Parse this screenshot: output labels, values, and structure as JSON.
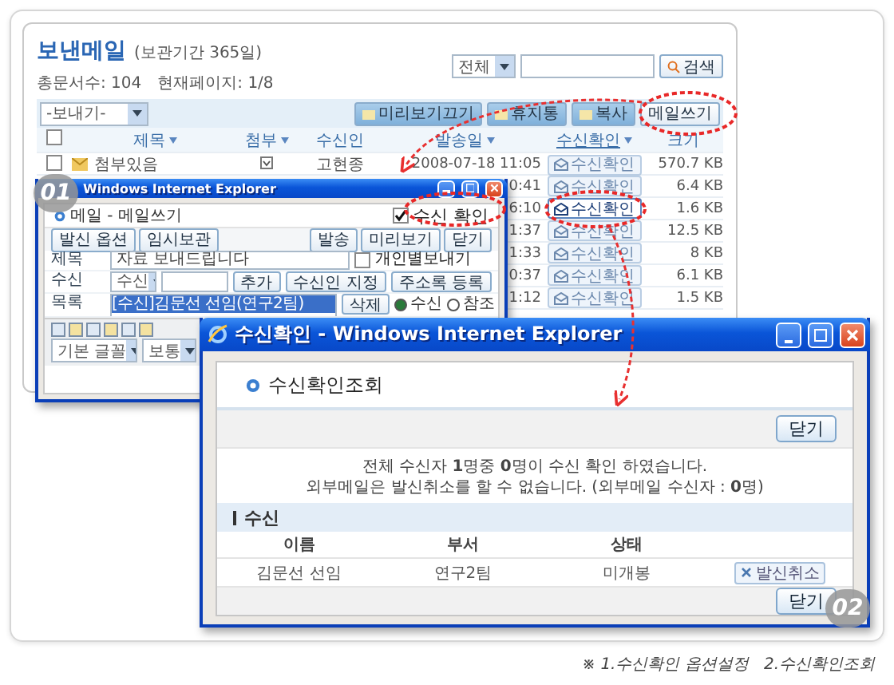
{
  "mail_list": {
    "title": "보낸메일",
    "retention": "(보관기간 365일)",
    "total_label": "총문서수: 104",
    "page_label": "현재페이지: 1/8",
    "search": {
      "scope": "전체",
      "button": "검색"
    },
    "send_select": "-보내기-",
    "toolbar": [
      "미리보기끄기",
      "휴지통",
      "복사"
    ],
    "compose_button": "메일쓰기",
    "select_all_checked": false,
    "columns": [
      {
        "label": "제목",
        "sortable": true
      },
      {
        "label": "첨부",
        "sortable": true
      },
      {
        "label": "수신인",
        "sortable": false
      },
      {
        "label": "발송일",
        "sortable": true
      },
      {
        "label": "수신확인",
        "sortable": true
      },
      {
        "label": "크기",
        "sortable": false
      }
    ],
    "rows": [
      {
        "checked": false,
        "subject": "첨부있음",
        "attachment": true,
        "recipient": "고현종",
        "sent": "2008-07-18 11:05",
        "receipt": "수신확인",
        "size": "570.7 KB",
        "highlighted": false
      },
      {
        "sent": "0:41",
        "receipt": "수신확인",
        "size": "6.4 KB",
        "highlighted": false
      },
      {
        "sent": "6:10",
        "receipt": "수신확인",
        "size": "1.6 KB",
        "highlighted": true
      },
      {
        "sent": "1:37",
        "receipt": "수신확인",
        "size": "12.5 KB",
        "highlighted": false
      },
      {
        "sent": "1:33",
        "receipt": "수신확인",
        "size": "8 KB",
        "highlighted": false
      },
      {
        "sent": "0:37",
        "receipt": "수신확인",
        "size": "6.1 KB",
        "highlighted": false
      },
      {
        "sent": "1:12",
        "receipt": "수신확인",
        "size": "1.5 KB",
        "highlighted": false
      }
    ]
  },
  "compose_window": {
    "title": "Windows Internet Explorer",
    "badge": "01",
    "heading": "메일 - 메일쓰기",
    "receipt_option": {
      "label": "수신 확인",
      "checked": true
    },
    "left_buttons": [
      "발신 옵션",
      "임시보관"
    ],
    "right_buttons": [
      "발송",
      "미리보기",
      "닫기"
    ],
    "subject_label": "제목",
    "subject_value": "자료 보내드립니다",
    "individual_option": {
      "label": "개인별보내기",
      "checked": false
    },
    "recipient_label": "수신",
    "recipient_type": "수신",
    "recipient_buttons": [
      "추가",
      "수신인 지정",
      "주소록 등록"
    ],
    "list_label": "목록",
    "list_items": [
      {
        "text": "[수신]김문선 선임(연구2팀)",
        "selected": true
      }
    ],
    "delete_button": "삭제",
    "recipient_kinds": [
      {
        "label": "수신",
        "selected": true
      },
      {
        "label": "참조",
        "selected": false
      }
    ],
    "font_select": "기본 글꼴",
    "size_select": "보통"
  },
  "receipt_window": {
    "title": "수신확인 - Windows Internet Explorer",
    "badge": "02",
    "heading": "수신확인조회",
    "close_button": "닫기",
    "message": [
      "전체 수신자 **1**명중 **0**명이 수신 확인 하였습니다.",
      "외부메일은 발신취소를 할 수 없습니다. (외부메일 수신자 : **0**명)"
    ],
    "section": "수신",
    "columns": [
      "이름",
      "부서",
      "상태"
    ],
    "rows": [
      {
        "name": "김문선 선임",
        "department": "연구2팀",
        "status": "미개봉",
        "action": "발신취소"
      }
    ],
    "footer_button": "닫기"
  },
  "caption": "※ 1.수신확인 옵션설정   2.수신확인조회"
}
